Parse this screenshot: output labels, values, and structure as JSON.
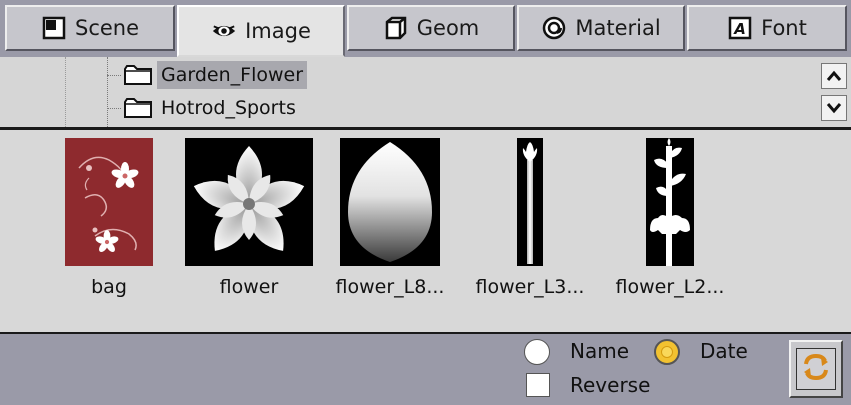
{
  "tabs": [
    {
      "label": "Scene",
      "icon": "scene-icon",
      "active": false
    },
    {
      "label": "Image",
      "icon": "eye-icon",
      "active": true
    },
    {
      "label": "Geom",
      "icon": "geom-icon",
      "active": false
    },
    {
      "label": "Material",
      "icon": "material-icon",
      "active": false
    },
    {
      "label": "Font",
      "icon": "font-icon",
      "active": false
    }
  ],
  "tree": {
    "items": [
      {
        "label": "Garden_Flower",
        "icon": "folder-icon",
        "selected": true
      },
      {
        "label": "Hotrod_Sports",
        "icon": "folder-icon",
        "selected": false
      }
    ]
  },
  "thumbnails": [
    {
      "caption": "bag",
      "image": "bag-image"
    },
    {
      "caption": "flower",
      "image": "flower-image"
    },
    {
      "caption": "flower_L8...",
      "image": "petal-gradient-image"
    },
    {
      "caption": "flower_L3...",
      "image": "stem-image"
    },
    {
      "caption": "flower_L2...",
      "image": "plant-silhouette-image"
    }
  ],
  "sort": {
    "name_label": "Name",
    "date_label": "Date",
    "selected": "Date",
    "reverse_label": "Reverse",
    "reverse_checked": false
  },
  "refresh_icon": "refresh-icon",
  "colors": {
    "bar": "#9a9aa8",
    "panel": "#d8d8d8",
    "bag_red": "#8e2a2e",
    "radio_on": "#f2c230"
  }
}
